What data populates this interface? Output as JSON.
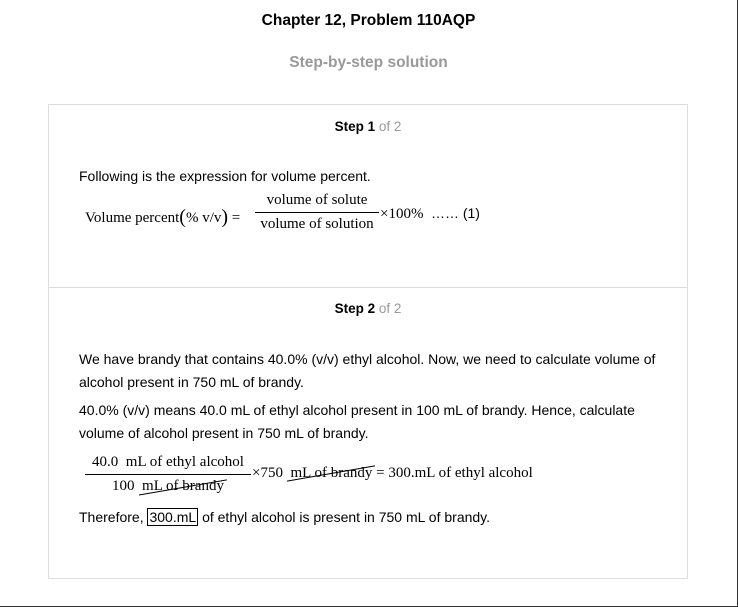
{
  "header": {
    "title": "Chapter 12, Problem 110AQP",
    "subtitle": "Step-by-step solution"
  },
  "step1": {
    "label": "Step 1",
    "of": "of 2",
    "intro": "Following is the expression for volume percent.",
    "equation": {
      "lhs_label": "Volume percent",
      "lhs_unit": "% v/v",
      "numerator": "volume of solute",
      "denominator": "volume of solution",
      "multiplier": "×100%",
      "reference": "…… (1)"
    }
  },
  "step2": {
    "label": "Step 2",
    "of": "of 2",
    "para1": "We have brandy that contains 40.0% (v/v) ethyl alcohol. Now, we need to calculate volume of alcohol present in 750 mL of brandy.",
    "para2": "40.0% (v/v) means 40.0 mL of ethyl alcohol present in 100 mL of brandy. Hence, calculate volume of alcohol present in 750 mL of brandy.",
    "equation": {
      "numerator_value": "40.0",
      "numerator_unit": "mL of ethyl alcohol",
      "denominator_value": "100",
      "denominator_unit": "mL of brandy",
      "times_value": "×750",
      "times_unit": "mL of brandy",
      "result": "= 300.mL of ethyl alcohol"
    },
    "conclusion_prefix": "Therefore,",
    "conclusion_answer": "300.mL",
    "conclusion_suffix": "of ethyl alcohol is present in 750 mL of brandy."
  }
}
